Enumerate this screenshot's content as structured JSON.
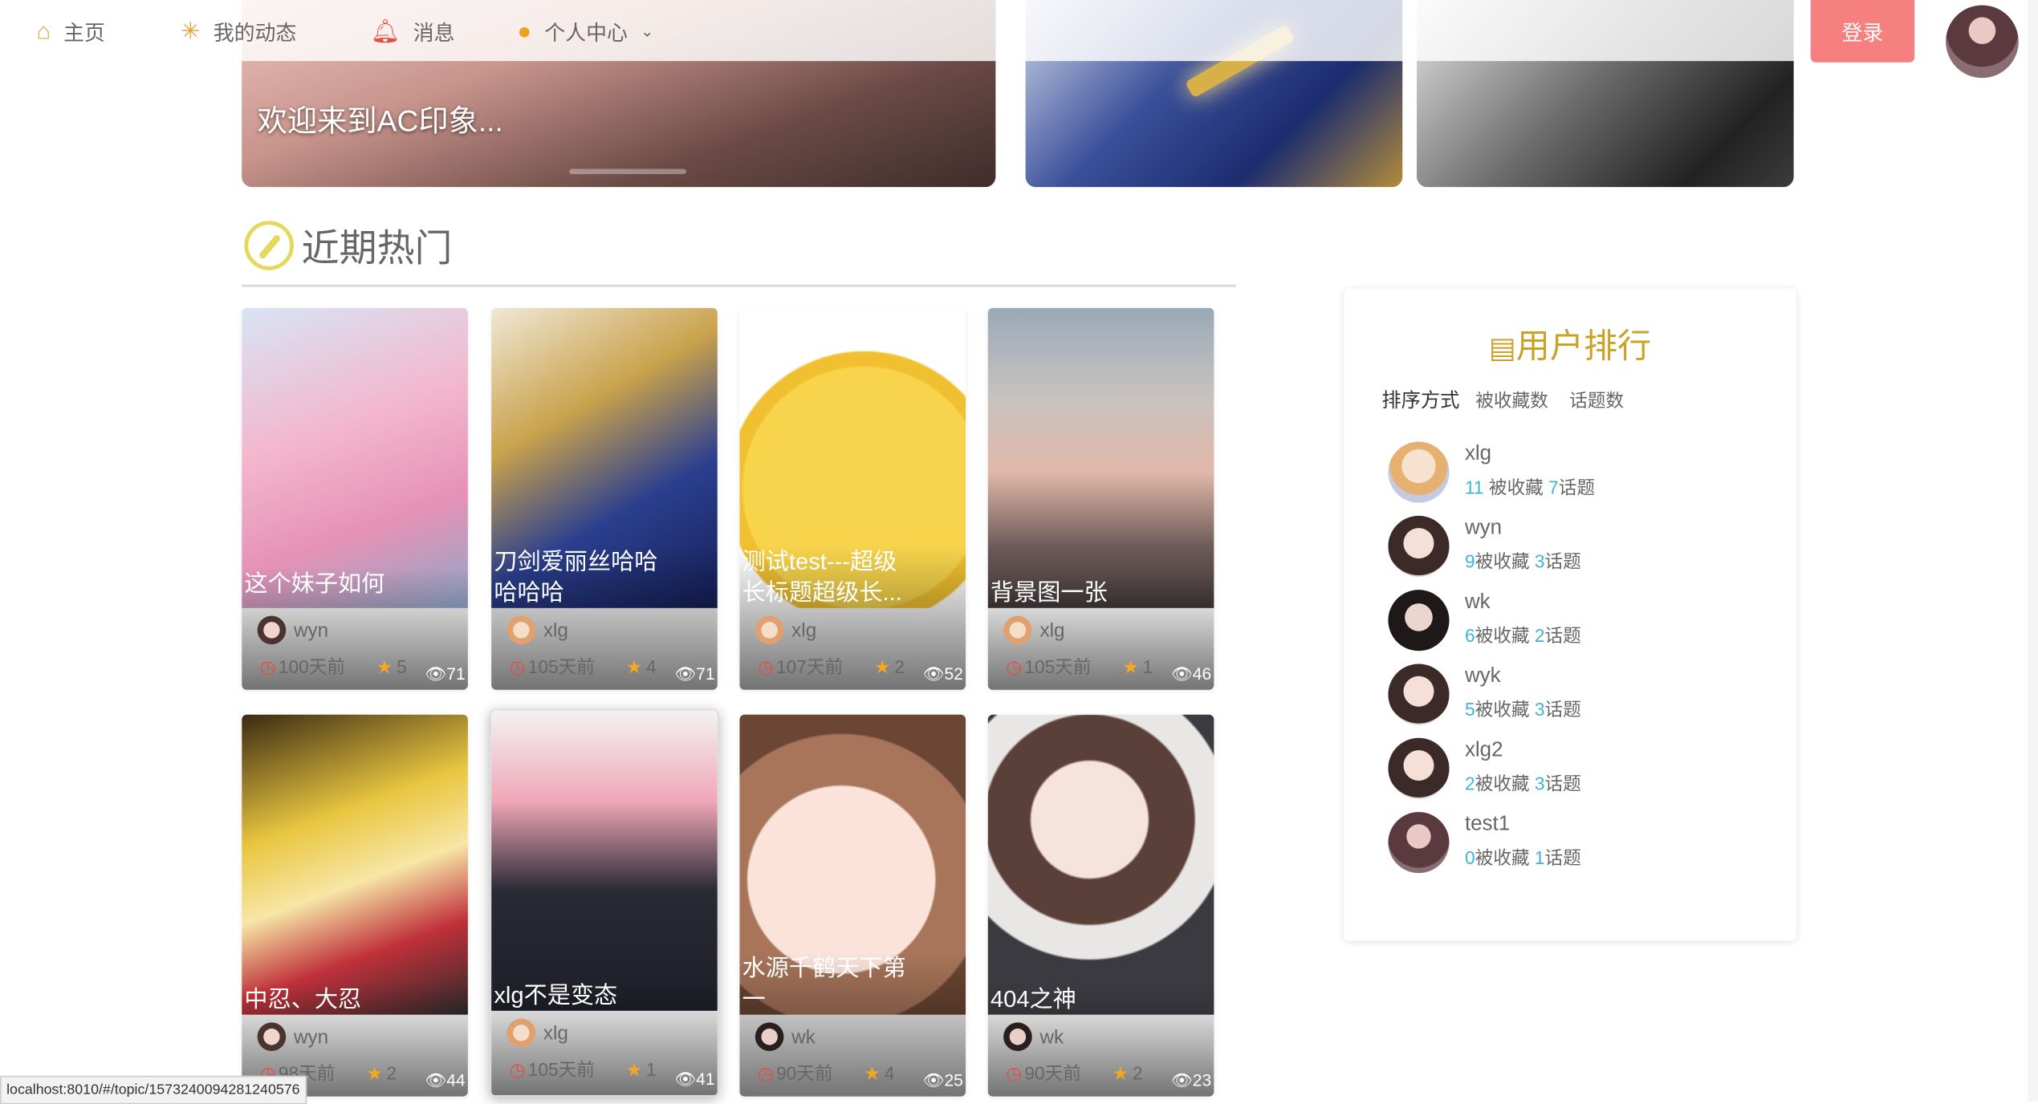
{
  "nav": {
    "items": [
      {
        "label": "主页",
        "icon": "home-icon"
      },
      {
        "label": "我的动态",
        "icon": "sparkle-icon"
      },
      {
        "label": "消息",
        "icon": "bell-icon"
      },
      {
        "label": "个人中心",
        "icon": "user-icon"
      }
    ],
    "login_label": "登录"
  },
  "banner": {
    "title": "欢迎来到AC印象..."
  },
  "hot": {
    "title": "近期热门"
  },
  "cards": [
    {
      "title": "这个妹子如何",
      "views": "71",
      "author": "wyn",
      "time": "100天前",
      "stars": "5"
    },
    {
      "title": "刀剑爱丽丝哈哈哈哈哈",
      "views": "71",
      "author": "xlg",
      "time": "105天前",
      "stars": "4"
    },
    {
      "title": "测试test---超级长标题超级长...",
      "views": "52",
      "author": "xlg",
      "time": "107天前",
      "stars": "2"
    },
    {
      "title": "背景图一张",
      "views": "46",
      "author": "xlg",
      "time": "105天前",
      "stars": "1"
    },
    {
      "title": "中忍、大忍",
      "views": "44",
      "author": "wyn",
      "time": "98天前",
      "stars": "2"
    },
    {
      "title": "xlg不是变态",
      "views": "41",
      "author": "xlg",
      "time": "105天前",
      "stars": "1"
    },
    {
      "title": "水源千鹤天下第一",
      "views": "25",
      "author": "wk",
      "time": "90天前",
      "stars": "4"
    },
    {
      "title": "404之神",
      "views": "23",
      "author": "wk",
      "time": "90天前",
      "stars": "2"
    }
  ],
  "ranking": {
    "title": "用户排行",
    "sort_label": "排序方式",
    "sort_options": [
      "被收藏数",
      "话题数"
    ],
    "collect_label": "被收藏",
    "topic_label": "话题",
    "users": [
      {
        "name": "xlg",
        "collected": "11",
        "topics": "7"
      },
      {
        "name": "wyn",
        "collected": "9",
        "topics": "3"
      },
      {
        "name": "wk",
        "collected": "6",
        "topics": "2"
      },
      {
        "name": "wyk",
        "collected": "5",
        "topics": "3"
      },
      {
        "name": "xlg2",
        "collected": "2",
        "topics": "3"
      },
      {
        "name": "test1",
        "collected": "0",
        "topics": "1"
      }
    ]
  },
  "status_url": "localhost:8010/#/topic/1573240094281240576",
  "colors": {
    "login": "#f67f7f",
    "rank_title": "#c9a227",
    "stat_number": "#3fb5d6",
    "clock": "#e54d42",
    "star": "#f5a623"
  }
}
